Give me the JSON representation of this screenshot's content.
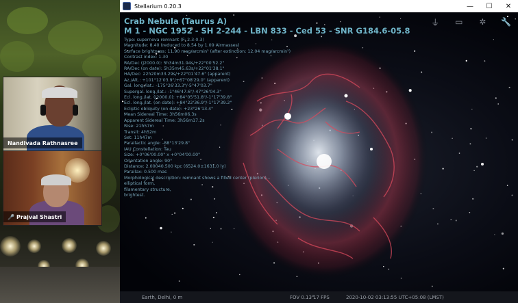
{
  "window": {
    "title": "Stellarium 0.20.3",
    "buttons": {
      "minimize": "—",
      "maximize": "☐",
      "close": "✕"
    }
  },
  "participants": [
    {
      "name": "Nandivada Rathnasree"
    },
    {
      "name": "Prajval Shastri"
    }
  ],
  "toolbar": {
    "icons": [
      "tripod-icon",
      "screen-icon",
      "wheel-icon",
      "wrench-icon"
    ]
  },
  "object": {
    "name": "Crab Nebula (Taurus A)",
    "designations": "M 1 - NGC 1952 - SH 2-244 - LBN 833 - Ced 53 - SNR G184.6-05.8",
    "lines": [
      "Type: supernova remnant (F: 2.3-0.3)",
      "Magnitude: 8.40 (reduced to 8.54 by 1.09 Airmasses)",
      "Surface brightness: 11.90 mag/arcmin² (after extinction: 12.04 mag/arcmin²)",
      "Contrast index: 1.30",
      "RA/Dec (J2000.0): 5h34m31.94s/+22°00'52.2\"",
      "RA/Dec (on date): 5h35m45.63s/+22°01'38.1\"",
      "HA/Dec: 22h20m33.29s/+22°01'47.6\" (apparent)",
      "Az./Alt.: +101°12'03.9\"/+67°08'29.0\" (apparent)",
      "Gal. long./lat.: -175°26'33.3\"/-5°47'03.7\"",
      "Supergal. long./lat.: -1°46'47.6\"/-47°26'04.3\"",
      "Ecl. long./lat. (J2000.0): +84°05'51.8\"/-1°17'39.8\"",
      "Ecl. long./lat. (on date): +84°22'36.9\"/-1°17'39.2\"",
      "Ecliptic obliquity (on date): +23°26'13.4\"",
      "Mean Sidereal Time: 3h56m06.3s",
      "Apparent Sidereal Time: 3h56m17.2s",
      "Rise: 21h57m",
      "Transit: 4h52m",
      "Set: 11h47m",
      "Parallactic angle: -88°13'29.8\"",
      "IAU Constellation: Tau",
      "Size: +0°06'00.00\" x +0°04'00.00\"",
      "Orientation angle: 90°",
      "Distance: 2.00040.500 kpc (6524.0±1631.0 ly)",
      "Parallax: 0.500 mas",
      "Morphological description: remnant shows a filled center (plerion)...",
      "elliptical form,",
      "filamentary structure,",
      "brightest."
    ]
  },
  "status": {
    "location": "Earth, Delhi, 0 m",
    "fov": "FOV 0.13°",
    "fps": "17 FPS",
    "datetime": "2020-10-02 03:13:55 UTC+05:08 (LMST)"
  }
}
